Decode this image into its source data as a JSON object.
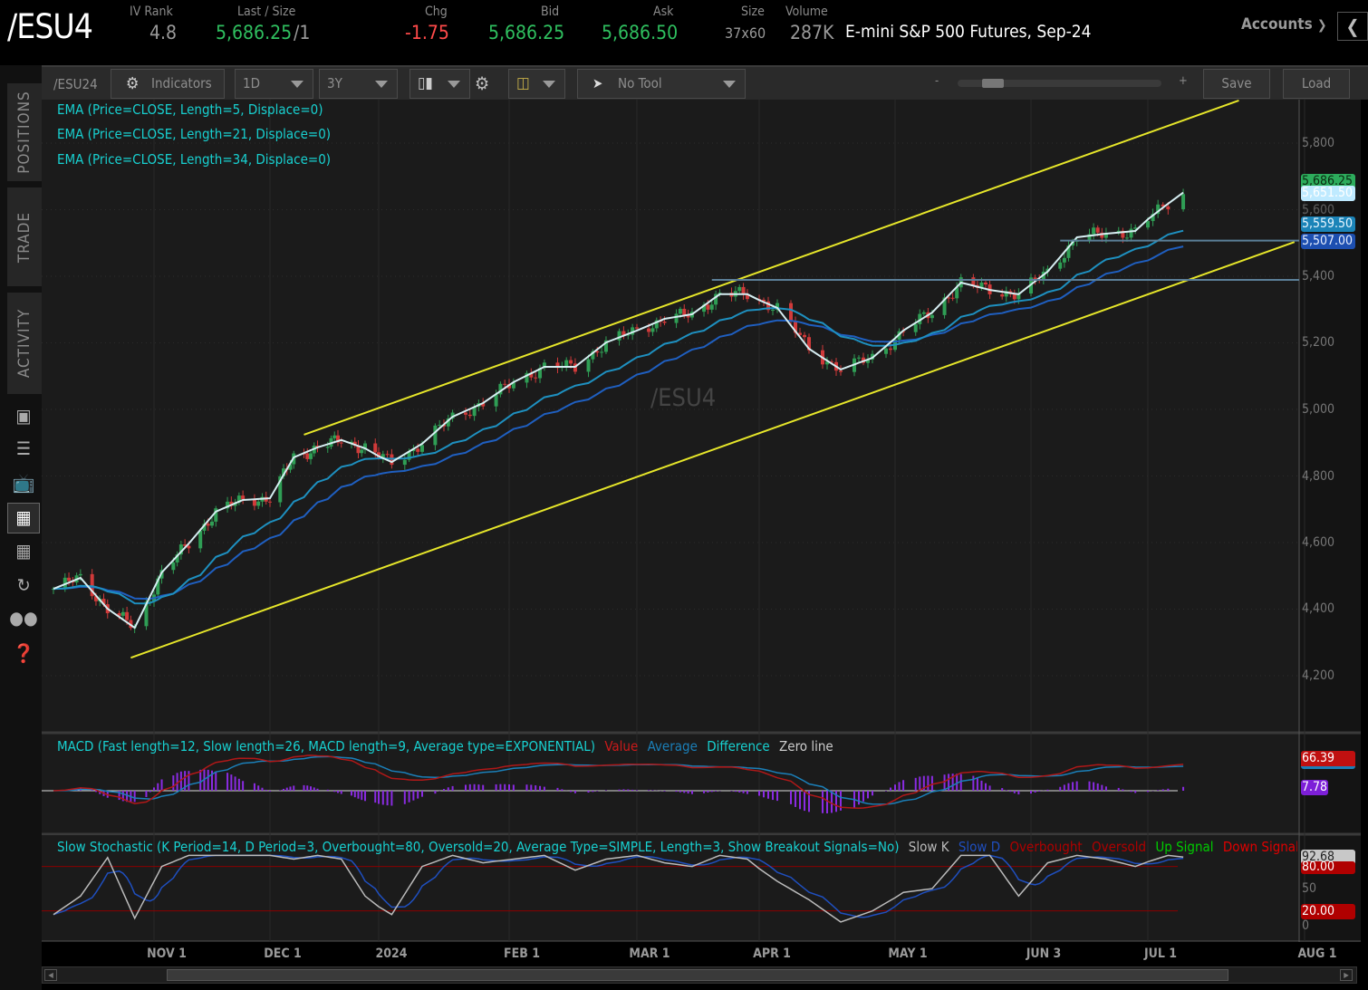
{
  "header": {
    "symbol": "/ESU4",
    "iv_rank": {
      "label": "IV Rank",
      "value": "4.8"
    },
    "last_size": {
      "label": "Last / Size",
      "value": "5,686.25",
      "size": "/1"
    },
    "chg": {
      "label": "Chg",
      "value": "-1.75"
    },
    "bid": {
      "label": "Bid",
      "value": "5,686.25"
    },
    "ask": {
      "label": "Ask",
      "value": "5,686.50"
    },
    "size": {
      "label": "Size",
      "value": "37x60"
    },
    "volume": {
      "label": "Volume",
      "value": "287K"
    },
    "description": "E-mini S&P 500 Futures, Sep-24",
    "accounts": "Accounts",
    "collapse_icon": "chevron-left-icon"
  },
  "sidebar": {
    "tabs": [
      "POSITIONS",
      "TRADE",
      "ACTIVITY"
    ],
    "icons": [
      "news-icon",
      "list-icon",
      "tv-icon",
      "chart-icon",
      "grid-icon",
      "history-icon",
      "community-icon",
      "help-icon"
    ],
    "active_icon": "chart-icon"
  },
  "toolbar": {
    "symbol": "/ESU24",
    "indicators": "Indicators",
    "aggregation": "1D",
    "timeframe": "3Y",
    "drawing_tool": "No Tool",
    "zoom_minus": "-",
    "zoom_plus": "+",
    "zoom_level": 0.15,
    "save": "Save",
    "load": "Load"
  },
  "chart": {
    "watermark": "/ESU4",
    "studies": [
      "EMA (Price=CLOSE, Length=5, Displace=0)",
      "EMA (Price=CLOSE, Length=21, Displace=0)",
      "EMA (Price=CLOSE, Length=34, Displace=0)"
    ],
    "price_axis": [
      "5,800",
      "5,600",
      "5,400",
      "5,200",
      "5,000",
      "4,800",
      "4,600",
      "4,400",
      "4,200"
    ],
    "price_tags": [
      {
        "label": "5,686.25",
        "bg": "#2dac5c",
        "fg": "#0a2a12"
      },
      {
        "label": "5,651.50",
        "bg": "#bfeaff",
        "fg": "#ffffff"
      },
      {
        "label": "5,600",
        "bg": "transparent",
        "fg": "#555"
      },
      {
        "label": "5,559.50",
        "bg": "#1b84b8",
        "fg": "#e8f6ff"
      },
      {
        "label": "5,507.00",
        "bg": "#1d4fb0",
        "fg": "#e8f0ff"
      }
    ],
    "x_axis": {
      "ticks": [
        {
          "label": "NOV 1",
          "date": "2023-11-01"
        },
        {
          "label": "DEC 1",
          "date": "2023-12-01"
        },
        {
          "label": "2024",
          "date": "2024-01-02"
        },
        {
          "label": "FEB 1",
          "date": "2024-02-01"
        },
        {
          "label": "MAR 1",
          "date": "2024-03-01"
        },
        {
          "label": "APR 1",
          "date": "2024-04-01"
        },
        {
          "label": "MAY 1",
          "date": "2024-05-01"
        },
        {
          "label": "JUN 3",
          "date": "2024-06-03"
        },
        {
          "label": "JUL 1",
          "date": "2024-07-01"
        },
        {
          "label": "AUG 1",
          "date": "2024-08-01"
        }
      ]
    },
    "ema5_weekly": [
      [
        "2023-10-06",
        4461
      ],
      [
        "2023-10-13",
        4494
      ],
      [
        "2023-10-20",
        4401
      ],
      [
        "2023-10-27",
        4344
      ],
      [
        "2023-11-03",
        4510
      ],
      [
        "2023-11-10",
        4597
      ],
      [
        "2023-11-17",
        4693
      ],
      [
        "2023-11-24",
        4728
      ],
      [
        "2023-12-01",
        4733
      ],
      [
        "2023-12-08",
        4856
      ],
      [
        "2023-12-15",
        4886
      ],
      [
        "2023-12-22",
        4908
      ],
      [
        "2023-12-29",
        4883
      ],
      [
        "2024-01-05",
        4842
      ],
      [
        "2024-01-12",
        4897
      ],
      [
        "2024-01-19",
        4978
      ],
      [
        "2024-01-26",
        5019
      ],
      [
        "2024-02-02",
        5082
      ],
      [
        "2024-02-09",
        5128
      ],
      [
        "2024-02-16",
        5128
      ],
      [
        "2024-02-23",
        5201
      ],
      [
        "2024-03-01",
        5237
      ],
      [
        "2024-03-08",
        5272
      ],
      [
        "2024-03-15",
        5286
      ],
      [
        "2024-03-22",
        5346
      ],
      [
        "2024-03-29",
        5346
      ],
      [
        "2024-04-05",
        5305
      ],
      [
        "2024-04-12",
        5182
      ],
      [
        "2024-04-19",
        5120
      ],
      [
        "2024-04-26",
        5155
      ],
      [
        "2024-05-03",
        5237
      ],
      [
        "2024-05-10",
        5291
      ],
      [
        "2024-05-17",
        5381
      ],
      [
        "2024-05-24",
        5359
      ],
      [
        "2024-05-31",
        5346
      ],
      [
        "2024-06-07",
        5414
      ],
      [
        "2024-06-14",
        5517
      ],
      [
        "2024-06-21",
        5528
      ],
      [
        "2024-06-28",
        5536
      ],
      [
        "2024-07-05",
        5618
      ],
      [
        "2024-07-08",
        5651.5
      ]
    ],
    "channel_lines": [
      {
        "from": [
          "2023-12-11",
          4924
        ],
        "to": [
          "2024-07-19",
          5928
        ],
        "color": "#e6e62a"
      },
      {
        "from": [
          "2023-10-26",
          4254
        ],
        "to": [
          "2024-07-30",
          5503
        ],
        "color": "#e6e62a"
      }
    ],
    "horizontal_levels": [
      {
        "price": 5507,
        "from": "2024-06-10",
        "color": "#5b7f98"
      },
      {
        "price": 5389,
        "from": "2024-03-20",
        "color": "#5b7f98"
      }
    ]
  },
  "macd": {
    "title": "MACD (Fast length=12, Slow length=26, MACD length=9, Average type=EXPONENTIAL)",
    "legend": [
      {
        "label": "Value",
        "color": "#cc1a1a"
      },
      {
        "label": "Average",
        "color": "#1b7fb8"
      },
      {
        "label": "Difference",
        "color": "#18d0d0"
      },
      {
        "label": "Zero line",
        "color": "#cccccc"
      }
    ],
    "value_tag": "66.39",
    "diff_tag": "7.78"
  },
  "stochastic": {
    "title": "Slow Stochastic (K Period=14, D Period=3, Overbought=80, Oversold=20, Average Type=SIMPLE, Length=3, Show Breakout Signals=No)",
    "legend": [
      {
        "label": "Slow K",
        "color": "#bbbbbb"
      },
      {
        "label": "Slow D",
        "color": "#1f4fbf"
      },
      {
        "label": "Overbought",
        "color": "#b00000"
      },
      {
        "label": "Oversold",
        "color": "#b00000"
      },
      {
        "label": "Up Signal",
        "color": "#00cc00"
      },
      {
        "label": "Down Signal",
        "color": "#e00000"
      }
    ],
    "axis": [
      "50",
      "0"
    ],
    "k_tag": "92.68",
    "overbought_tag": "80.00",
    "oversold_tag": "20.00",
    "overbought": 80,
    "oversold": 20,
    "k_weekly": [
      15,
      40,
      92,
      10,
      80,
      95,
      95,
      95,
      95,
      90,
      95,
      90,
      40,
      15,
      80,
      95,
      85,
      90,
      95,
      75,
      90,
      95,
      85,
      80,
      95,
      90,
      60,
      35,
      5,
      20,
      45,
      50,
      95,
      95,
      40,
      85,
      95,
      90,
      80,
      95,
      92.68
    ]
  }
}
